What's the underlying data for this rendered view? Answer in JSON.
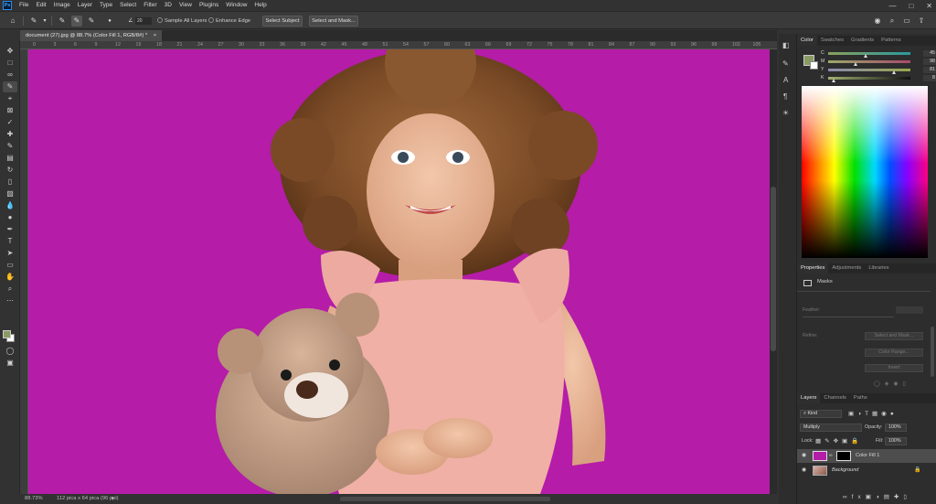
{
  "app": {
    "logo": "Ps"
  },
  "menu": [
    "File",
    "Edit",
    "Image",
    "Layer",
    "Type",
    "Select",
    "Filter",
    "3D",
    "View",
    "Plugins",
    "Window",
    "Help"
  ],
  "options_bar": {
    "brush_size": "20",
    "sample_all_layers": "Sample All Layers",
    "enhance_edge": "Enhance Edge",
    "select_subject": "Select Subject",
    "select_and_mask": "Select and Mask..."
  },
  "document": {
    "tab_title": "document (27).jpg @ 88.7% (Color Fill 1, RGB/8#) *",
    "zoom": "88.73%",
    "doc_size": "112 pica x 64 pica (96 ppi)"
  },
  "ruler_h_labels": [
    "0",
    "3",
    "6",
    "9",
    "12",
    "15",
    "18",
    "21",
    "24",
    "27",
    "30",
    "33",
    "36",
    "39",
    "42",
    "45",
    "48",
    "51",
    "54",
    "57",
    "60",
    "63",
    "66",
    "69",
    "72",
    "75",
    "78",
    "81",
    "84",
    "87",
    "90",
    "93",
    "96",
    "99",
    "102",
    "105"
  ],
  "color_panel": {
    "tabs": [
      "Color",
      "Swatches",
      "Gradients",
      "Patterns"
    ],
    "sliders": [
      {
        "label": "C",
        "value": "45"
      },
      {
        "label": "M",
        "value": "98"
      },
      {
        "label": "Y",
        "value": "81"
      },
      {
        "label": "K",
        "value": "8"
      }
    ]
  },
  "properties_panel": {
    "tabs": [
      "Properties",
      "Adjustments",
      "Libraries"
    ],
    "section": "Masks",
    "feather_label": "Feather:",
    "refine_label": "Refine:",
    "buttons": [
      "Select and Mask...",
      "Color Range...",
      "Invert"
    ]
  },
  "layers_panel": {
    "tabs": [
      "Layers",
      "Channels",
      "Paths"
    ],
    "filter_kind": "Kind",
    "blend_mode": "Multiply",
    "opacity_label": "Opacity:",
    "opacity": "100%",
    "lock_label": "Lock:",
    "fill_label": "Fill:",
    "fill": "100%",
    "layers": [
      {
        "name": "Color Fill 1"
      },
      {
        "name": "Background"
      }
    ]
  },
  "colors": {
    "canvas_bg": "#b51ca8",
    "swatch_fg": "#8a9a63",
    "layer_fill_thumb": "#b51ca8"
  }
}
